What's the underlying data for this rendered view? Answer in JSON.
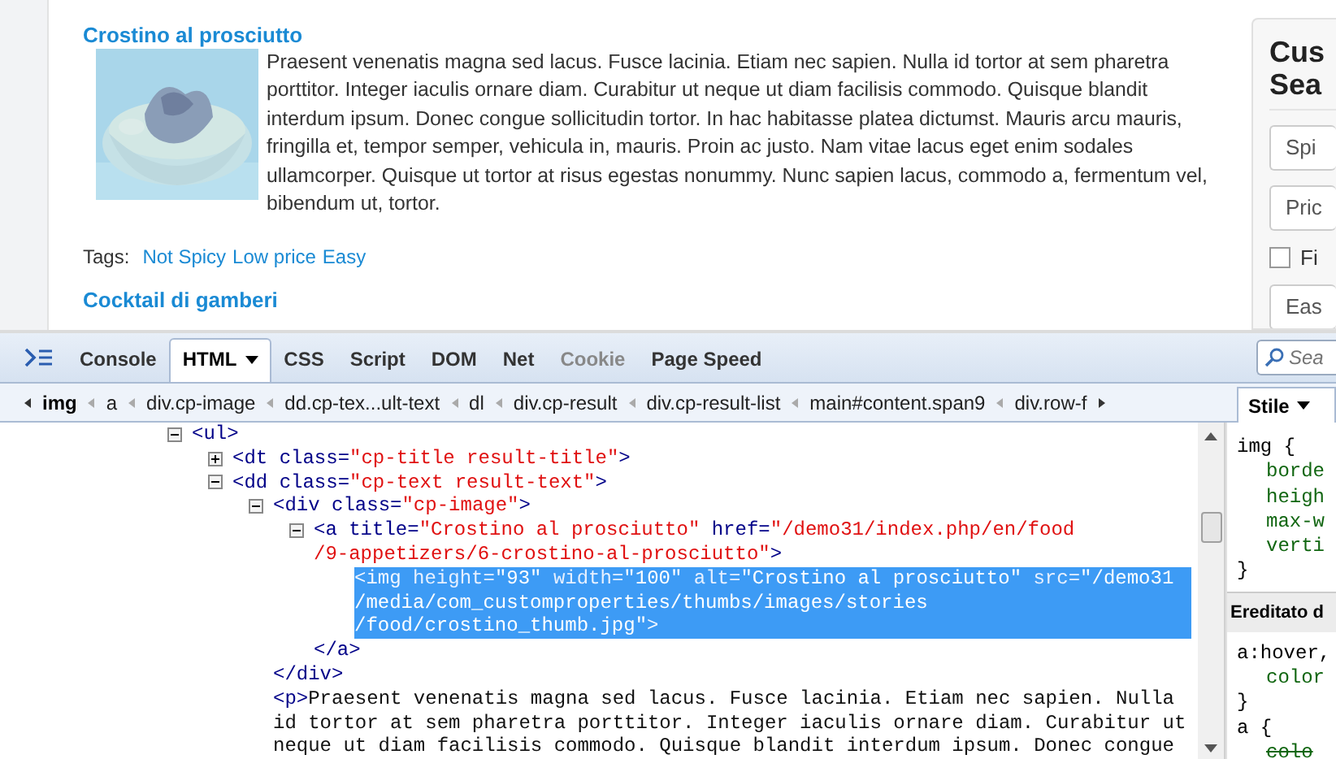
{
  "page": {
    "article": {
      "title": "Crostino al prosciutto",
      "image": {
        "kind": "picture"
      },
      "text": "Praesent venenatis magna sed lacus. Fusce lacinia. Etiam nec sapien. Nulla id tortor at sem pharetra porttitor. Integer iaculis ornare diam. Curabitur ut neque ut diam facilisis commodo. Quisque blandit interdum ipsum. Donec congue sollicitudin tortor. In hac habitasse platea dictumst. Mauris arcu mauris, fringilla et, tempor semper, vehicula in, mauris. Proin ac justo. Nam vitae lacus eget enim sodales ullamcorper. Quisque ut tortor at risus egestas nonummy. Nunc sapien lacus, commodo a, fermentum vel, bibendum ut, tortor.",
      "tags_label": "Tags:",
      "tags": [
        "Not Spicy",
        "Low price",
        "Easy"
      ]
    },
    "next_title": "Cocktail di gamberi",
    "search_panel": {
      "title_lines": [
        "Cus",
        "Sea"
      ],
      "controls": [
        {
          "kind": "field",
          "value": "Spi"
        },
        {
          "kind": "field",
          "value": "Pric"
        },
        {
          "kind": "checkbox",
          "label": "Fi",
          "checked": false
        },
        {
          "kind": "field",
          "value": "Eas"
        }
      ]
    }
  },
  "devtools": {
    "tabs": [
      {
        "label": "Console",
        "selected": false,
        "disabled": false,
        "menu": false
      },
      {
        "label": "HTML",
        "selected": true,
        "disabled": false,
        "menu": true
      },
      {
        "label": "CSS",
        "selected": false,
        "disabled": false,
        "menu": false
      },
      {
        "label": "Script",
        "selected": false,
        "disabled": false,
        "menu": false
      },
      {
        "label": "DOM",
        "selected": false,
        "disabled": false,
        "menu": false
      },
      {
        "label": "Net",
        "selected": false,
        "disabled": false,
        "menu": false
      },
      {
        "label": "Cookie",
        "selected": false,
        "disabled": true,
        "menu": false
      },
      {
        "label": "Page Speed",
        "selected": false,
        "disabled": false,
        "menu": false
      }
    ],
    "search": {
      "placeholder": "Sea"
    },
    "breadcrumbs": [
      {
        "label": "img",
        "selected": true
      },
      {
        "label": "a",
        "selected": false
      },
      {
        "label": "div.cp-image",
        "selected": false
      },
      {
        "label": "dd.cp-tex...ult-text",
        "selected": false
      },
      {
        "label": "dl",
        "selected": false
      },
      {
        "label": "div.cp-result",
        "selected": false
      },
      {
        "label": "div.cp-result-list",
        "selected": false
      },
      {
        "label": "main#content.span9",
        "selected": false
      },
      {
        "label": "div.row-f",
        "selected": false
      }
    ],
    "side_tab": {
      "label": "Stile",
      "selected": true
    },
    "tree": [
      {
        "expanded": true,
        "lines": [
          [
            {
              "kind": "tag",
              "text": "<ul>"
            }
          ]
        ],
        "children": [
          {
            "expanded": false,
            "lines": [
              [
                {
                  "kind": "tag",
                  "text": "<dt "
                },
                {
                  "kind": "attr",
                  "text": "class="
                },
                {
                  "kind": "value",
                  "text": "\"cp-title result-title\""
                },
                {
                  "kind": "tag",
                  "text": ">"
                }
              ]
            ]
          },
          {
            "expanded": true,
            "lines": [
              [
                {
                  "kind": "tag",
                  "text": "<dd "
                },
                {
                  "kind": "attr",
                  "text": "class="
                },
                {
                  "kind": "value",
                  "text": "\"cp-text result-text\""
                },
                {
                  "kind": "tag",
                  "text": ">"
                }
              ]
            ],
            "children": [
              {
                "expanded": true,
                "lines": [
                  [
                    {
                      "kind": "tag",
                      "text": "<div "
                    },
                    {
                      "kind": "attr",
                      "text": "class="
                    },
                    {
                      "kind": "value",
                      "text": "\"cp-image\""
                    },
                    {
                      "kind": "tag",
                      "text": ">"
                    }
                  ]
                ],
                "close": [
                  {
                    "kind": "tag",
                    "text": "</div>"
                  }
                ],
                "children": [
                  {
                    "expanded": true,
                    "lines": [
                      [
                        {
                          "kind": "tag",
                          "text": "<a "
                        },
                        {
                          "kind": "attr",
                          "text": "title="
                        },
                        {
                          "kind": "value",
                          "text": "\"Crostino al prosciutto\""
                        },
                        {
                          "kind": "attr",
                          "text": " href="
                        },
                        {
                          "kind": "value",
                          "text": "\"/demo31/index.php/en/food"
                        }
                      ],
                      [
                        {
                          "kind": "value",
                          "text": "/9-appetizers/6-crostino-al-prosciutto\""
                        },
                        {
                          "kind": "tag",
                          "text": ">"
                        }
                      ]
                    ],
                    "close": [
                      {
                        "kind": "tag",
                        "text": "</a>"
                      }
                    ],
                    "children": [
                      {
                        "selected": true,
                        "lines": [
                          [
                            {
                              "kind": "tag",
                              "text": "<img "
                            },
                            {
                              "kind": "attr",
                              "text": "height="
                            },
                            {
                              "kind": "value",
                              "text": "\"93\""
                            },
                            {
                              "kind": "attr",
                              "text": " width="
                            },
                            {
                              "kind": "value",
                              "text": "\"100\""
                            },
                            {
                              "kind": "attr",
                              "text": " alt="
                            },
                            {
                              "kind": "value",
                              "text": "\"Crostino al prosciutto\""
                            },
                            {
                              "kind": "attr",
                              "text": " src="
                            },
                            {
                              "kind": "value",
                              "text": "\"/demo31"
                            }
                          ],
                          [
                            {
                              "kind": "value",
                              "text": "/media/com_customproperties/thumbs/images/stories"
                            }
                          ],
                          [
                            {
                              "kind": "value",
                              "text": "/food/crostino_thumb.jpg\""
                            },
                            {
                              "kind": "tag",
                              "text": ">"
                            }
                          ]
                        ]
                      }
                    ]
                  }
                ]
              },
              {
                "lines": [
                  [
                    {
                      "kind": "tag",
                      "text": "<p>"
                    },
                    {
                      "kind": "text",
                      "text": "Praesent venenatis magna sed lacus. Fusce lacinia. Etiam nec sapien. Nulla"
                    }
                  ],
                  [
                    {
                      "kind": "text",
                      "text": "id tortor at sem pharetra porttitor. Integer iaculis ornare diam. Curabitur ut"
                    }
                  ],
                  [
                    {
                      "kind": "text",
                      "text": "neque ut diam facilisis commodo. Quisque blandit interdum ipsum. Donec congue"
                    }
                  ]
                ]
              }
            ]
          }
        ]
      }
    ],
    "styles": [
      {
        "kind": "selector",
        "text": "img {"
      },
      {
        "kind": "prop",
        "text": "borde",
        "struck": false
      },
      {
        "kind": "prop",
        "text": "heigh",
        "struck": false
      },
      {
        "kind": "prop",
        "text": "max-w",
        "struck": false
      },
      {
        "kind": "prop",
        "text": "verti",
        "struck": false
      },
      {
        "kind": "close",
        "text": "}"
      },
      {
        "kind": "header",
        "text": "Ereditato d"
      },
      {
        "kind": "selector",
        "text": "a:hover,"
      },
      {
        "kind": "prop",
        "text": "color",
        "struck": false
      },
      {
        "kind": "close",
        "text": "}"
      },
      {
        "kind": "selector",
        "text": "a {"
      },
      {
        "kind": "prop",
        "text": "colo",
        "struck": true
      }
    ]
  }
}
